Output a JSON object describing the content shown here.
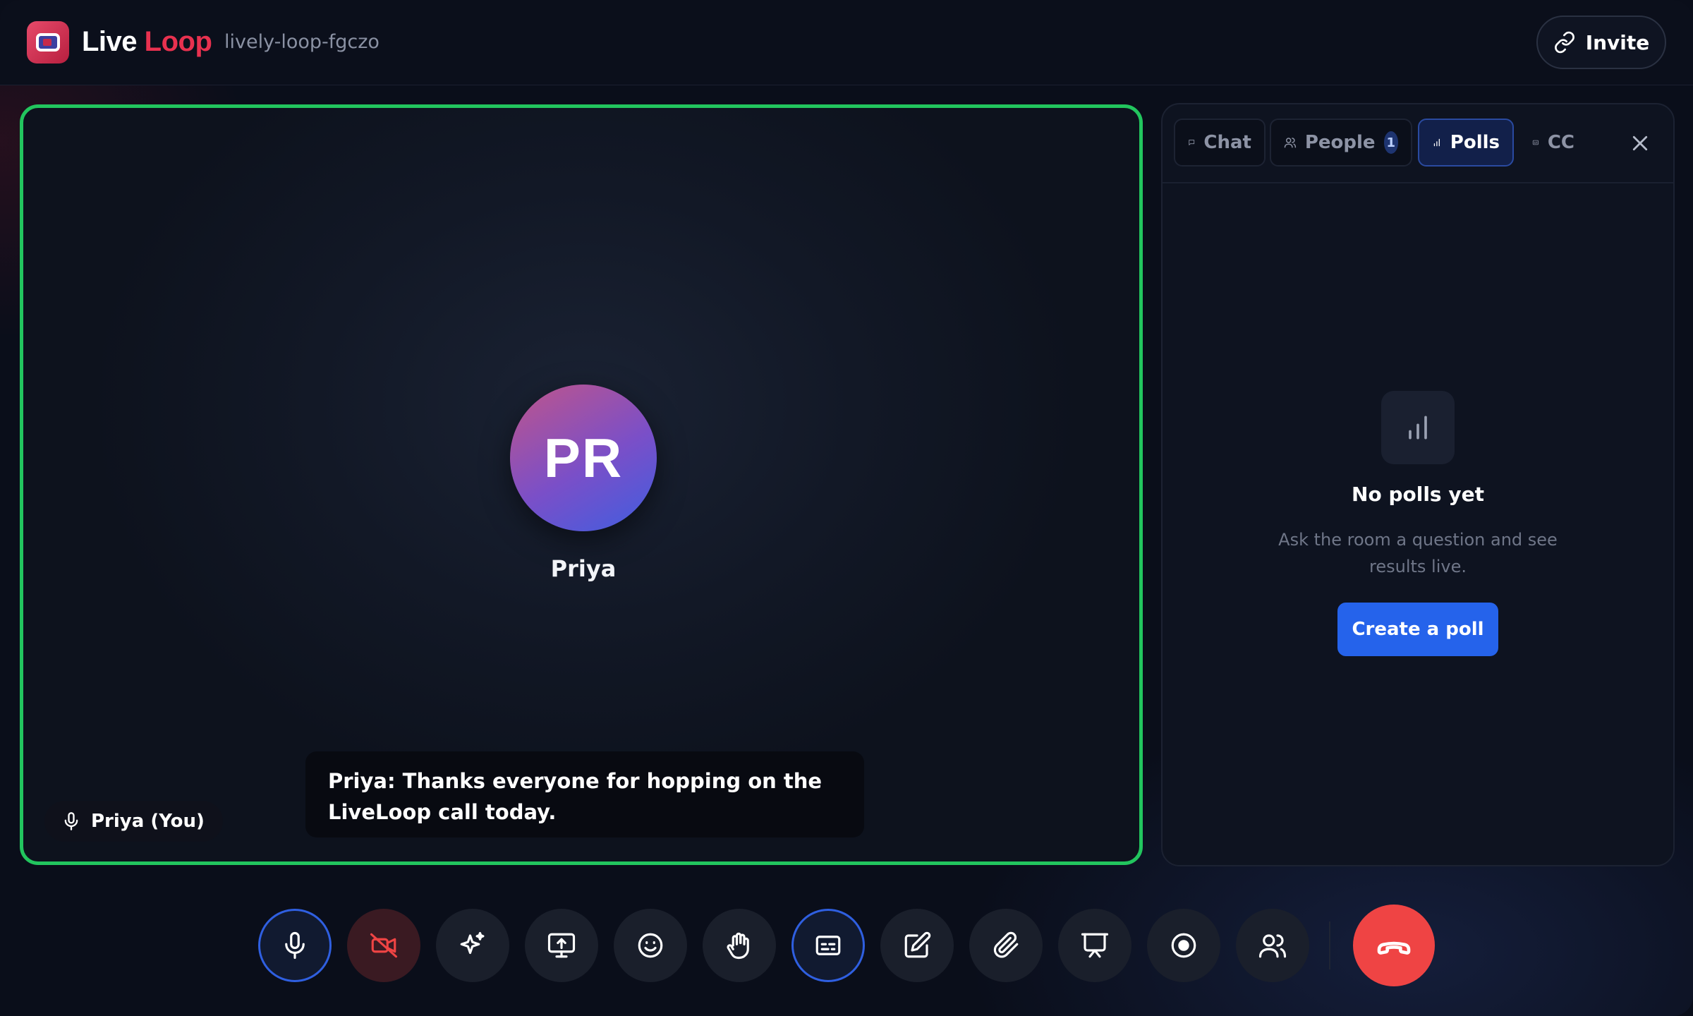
{
  "header": {
    "brand_part1": "Live",
    "brand_part2": "Loop",
    "room_id": "lively-loop-fgczo",
    "invite_label": "Invite"
  },
  "stage": {
    "avatar_initials": "PR",
    "participant_name": "Priya",
    "name_chip": "Priya (You)",
    "caption": "Priya: Thanks everyone for hopping on the LiveLoop call today.",
    "speaking_border_color": "#22c55e"
  },
  "panel": {
    "tabs": [
      {
        "label": "Chat",
        "icon": "chat-bubble-icon"
      },
      {
        "label": "People",
        "icon": "people-icon",
        "badge": "1"
      },
      {
        "label": "Polls",
        "icon": "bar-chart-icon",
        "active": true
      },
      {
        "label": "CC",
        "icon": "captions-icon"
      }
    ],
    "empty_title": "No polls yet",
    "empty_subtitle": "Ask the room a question and see results live.",
    "create_label": "Create a poll"
  },
  "controls": [
    {
      "name": "microphone",
      "icon": "microphone-icon",
      "active": true
    },
    {
      "name": "camera",
      "icon": "camera-off-icon",
      "state": "off"
    },
    {
      "name": "effects",
      "icon": "sparkles-icon"
    },
    {
      "name": "share-screen",
      "icon": "screen-share-icon"
    },
    {
      "name": "reactions",
      "icon": "smiley-icon"
    },
    {
      "name": "raise-hand",
      "icon": "hand-icon"
    },
    {
      "name": "captions",
      "icon": "captions-icon",
      "active": true
    },
    {
      "name": "whiteboard",
      "icon": "edit-icon"
    },
    {
      "name": "attach",
      "icon": "paperclip-icon"
    },
    {
      "name": "present",
      "icon": "presentation-icon"
    },
    {
      "name": "record",
      "icon": "record-icon"
    },
    {
      "name": "participants",
      "icon": "people-icon"
    },
    {
      "name": "end-call",
      "icon": "phone-hangup-icon"
    }
  ],
  "colors": {
    "accent": "#2563eb",
    "brand": "#e8314f",
    "danger": "#ef4444",
    "background": "#0a0e1a"
  }
}
